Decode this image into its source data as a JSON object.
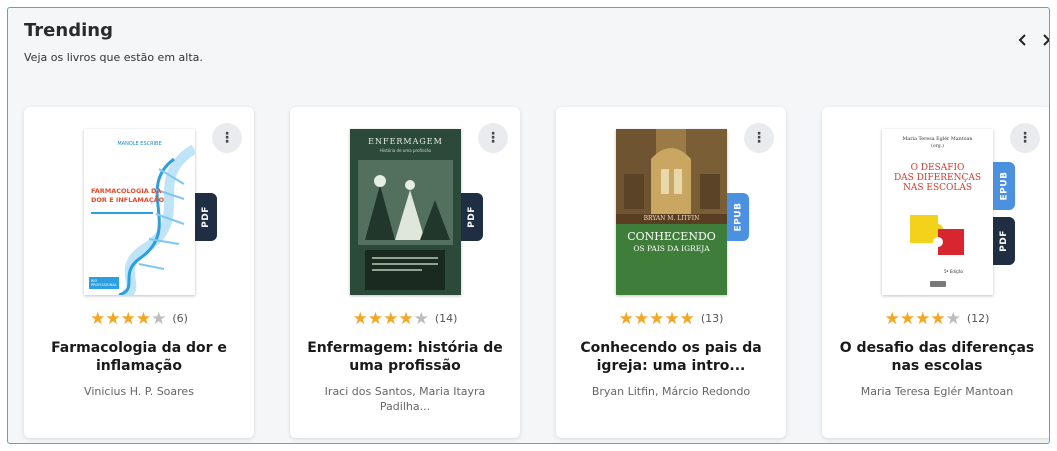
{
  "section": {
    "title": "Trending",
    "subtitle": "Veja os livros que estão em alta.",
    "prev_icon": "chevron-left-icon",
    "next_icon": "chevron-right-icon"
  },
  "colors": {
    "accent_border": "#31b3e3",
    "star": "#f5a623",
    "pdf_badge": "#1f2e42",
    "epub_badge": "#4c90e0"
  },
  "books": [
    {
      "title": "Farmacologia da dor e inflamação",
      "authors": "Vinicius H. P. Soares",
      "rating": 4,
      "rating_count": "(6)",
      "formats": [
        "PDF"
      ],
      "cover": {
        "publisher_text": "MANOLE ESCRIBE",
        "title_text": "FARMACOLOGIA DA\nDOR E INFLAMAÇÃO",
        "footer_text": "RIO PROFISSIONAL"
      }
    },
    {
      "title": "Enfermagem: história de uma profissão",
      "authors": "Iraci dos Santos, Maria Itayra Padilha...",
      "rating": 4,
      "rating_count": "(14)",
      "formats": [
        "PDF"
      ],
      "cover": {
        "title_text": "ENFERMAGEM",
        "subtitle_text": "História de uma profissão"
      }
    },
    {
      "title": "Conhecendo os pais da igreja: uma intro...",
      "authors": "Bryan Litfin, Márcio Redondo",
      "rating": 5,
      "rating_count": "(13)",
      "formats": [
        "EPUB"
      ],
      "cover": {
        "author_text": "BRYAN M. LITFIN",
        "title_line1": "CONHECENDO",
        "title_line2": "OS PAIS DA IGREJA"
      }
    },
    {
      "title": "O desafio das diferenças nas escolas",
      "authors": "Maria Teresa Eglér Mantoan",
      "rating": 4,
      "rating_count": "(12)",
      "formats": [
        "EPUB",
        "PDF"
      ],
      "cover": {
        "author_text": "Maria Teresa Eglér Mantoan",
        "org_text": "(org.)",
        "title_text": "O DESAFIO\nDAS DIFERENÇAS\nNAS ESCOLAS",
        "edition_text": "5ª Edição"
      }
    }
  ]
}
